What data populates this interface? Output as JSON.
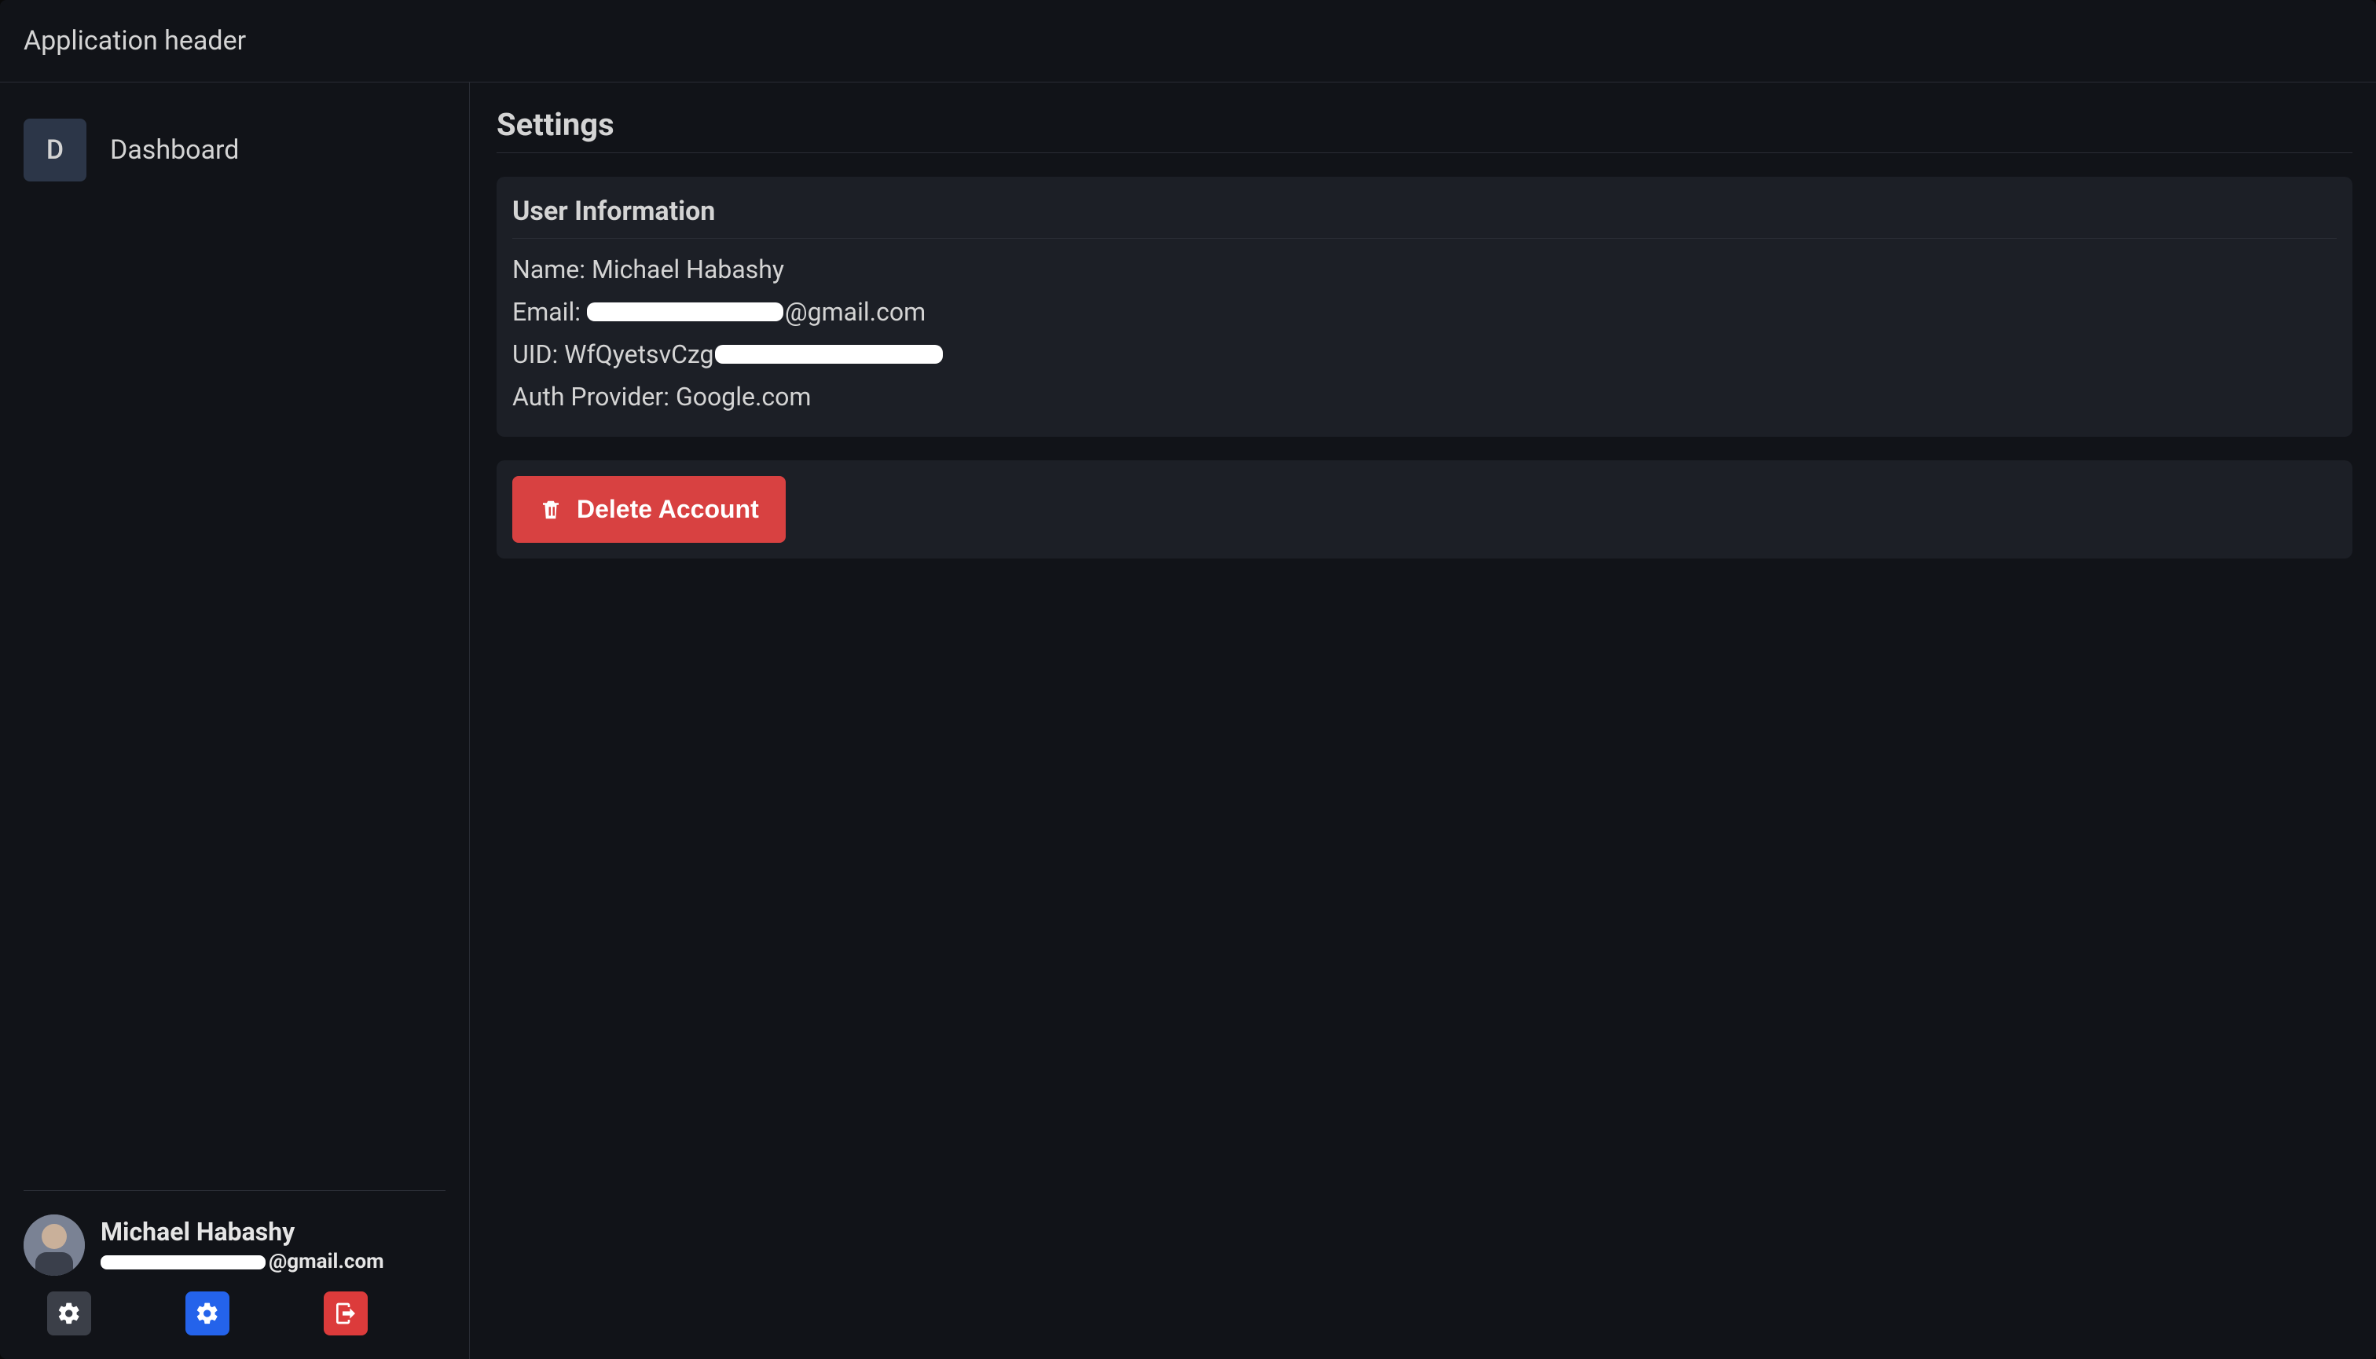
{
  "header": {
    "title": "Application header"
  },
  "sidebar": {
    "items": [
      {
        "badge": "D",
        "label": "Dashboard"
      }
    ],
    "user": {
      "name": "Michael Habashy",
      "email_suffix": "@gmail.com"
    }
  },
  "main": {
    "title": "Settings",
    "user_info": {
      "card_title": "User Information",
      "name_label": "Name: ",
      "name_value": "Michael Habashy",
      "email_label": "Email: ",
      "email_suffix": "@gmail.com",
      "uid_label": "UID: ",
      "uid_prefix": "WfQyetsvCzg",
      "auth_label": "Auth Provider: ",
      "auth_value": "Google.com"
    },
    "delete_button": "Delete Account"
  }
}
